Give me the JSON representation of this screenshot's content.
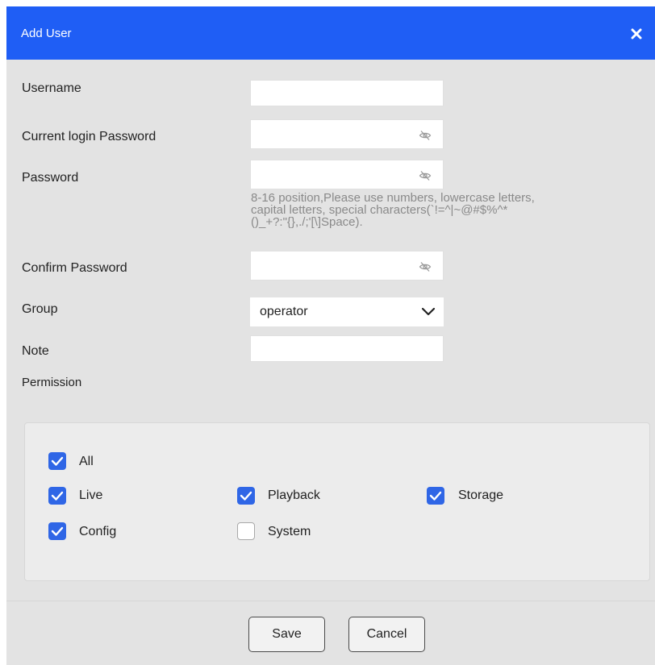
{
  "dialog": {
    "title": "Add User",
    "close_icon": "close-icon"
  },
  "form": {
    "username_label": "Username",
    "username_value": "",
    "current_password_label": "Current login Password",
    "current_password_value": "",
    "password_label": "Password",
    "password_value": "",
    "password_hint_lines": [
      "8-16 position,Please use numbers, lowercase letters,",
      "capital letters, special characters(`!=^|~@#$%^*",
      "()_+?:\"{},./;'[\\]Space)."
    ],
    "confirm_password_label": "Confirm Password",
    "confirm_password_value": "",
    "group_label": "Group",
    "group_value": "operator",
    "note_label": "Note",
    "note_value": "",
    "permission_label": "Permission",
    "eye_icon": "eye-hidden-icon"
  },
  "permissions": [
    {
      "label": "All",
      "checked": true
    },
    {
      "label": "Live",
      "checked": true
    },
    {
      "label": "Playback",
      "checked": true
    },
    {
      "label": "Storage",
      "checked": true
    },
    {
      "label": "Config",
      "checked": true
    },
    {
      "label": "System",
      "checked": false
    }
  ],
  "colors": {
    "header": "#1f5ef5",
    "checkbox_checked": "#2f66e6"
  },
  "footer": {
    "save_label": "Save",
    "cancel_label": "Cancel"
  }
}
